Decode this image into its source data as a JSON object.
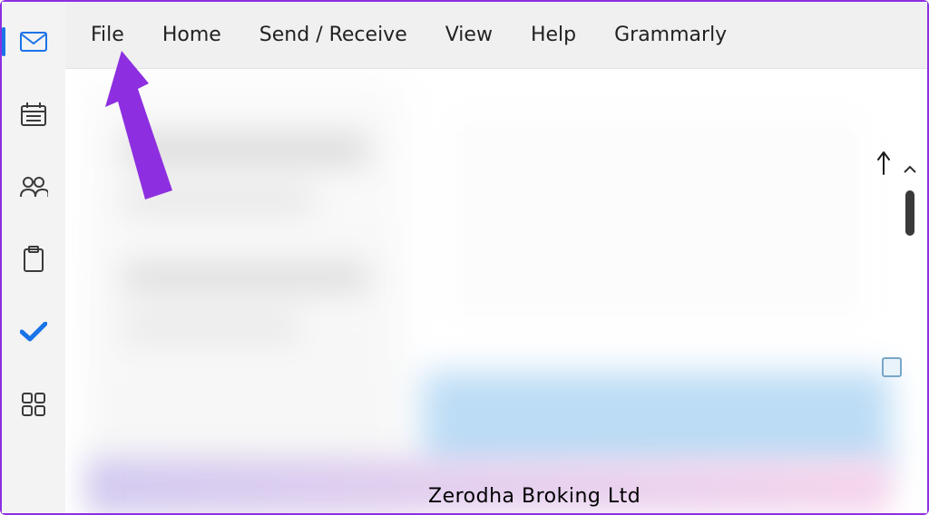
{
  "sidebar": {
    "items": [
      {
        "name": "mail-icon",
        "active": true
      },
      {
        "name": "calendar-icon",
        "active": false
      },
      {
        "name": "people-icon",
        "active": false
      },
      {
        "name": "tasks-icon",
        "active": false
      },
      {
        "name": "todo-icon",
        "active": false
      },
      {
        "name": "apps-icon",
        "active": false
      }
    ]
  },
  "ribbon": {
    "items": [
      {
        "id": "file",
        "label": "File"
      },
      {
        "id": "home",
        "label": "Home"
      },
      {
        "id": "sendreceive",
        "label": "Send / Receive"
      },
      {
        "id": "view",
        "label": "View"
      },
      {
        "id": "help",
        "label": "Help"
      },
      {
        "id": "grammarly",
        "label": "Grammarly"
      }
    ]
  },
  "content": {
    "partial_sender": "Zerodha Broking Ltd"
  },
  "annotation": {
    "target": "file"
  }
}
